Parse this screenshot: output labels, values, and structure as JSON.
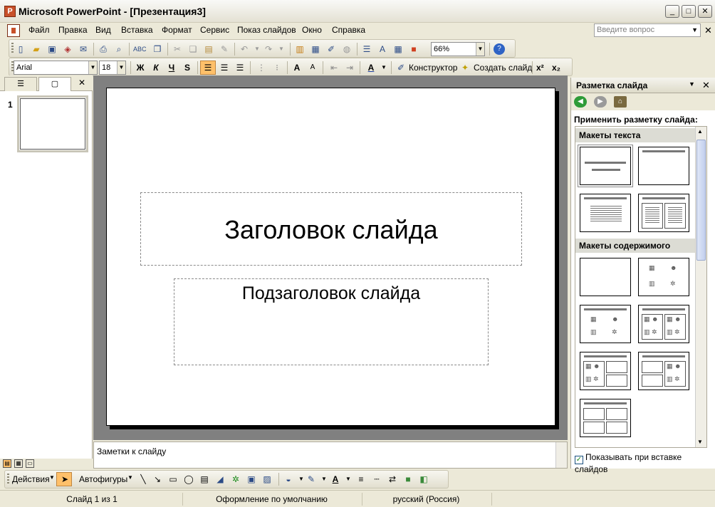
{
  "window": {
    "title": "Microsoft PowerPoint - [Презентация3]",
    "controls": {
      "minimize": "_",
      "maximize": "□",
      "close": "✕"
    }
  },
  "menubar": {
    "items": [
      "Файл",
      "Правка",
      "Вид",
      "Вставка",
      "Формат",
      "Сервис",
      "Показ слайдов",
      "Окно",
      "Справка"
    ],
    "ask_placeholder": "Введите вопрос",
    "close": "✕"
  },
  "standard_toolbar": {
    "zoom": "66%"
  },
  "formatting_toolbar": {
    "font": "Arial",
    "size": "18",
    "bold": "Ж",
    "italic": "К",
    "underline": "Ч",
    "shadow": "S",
    "designer": "Конструктор",
    "new_slide": "Создать слайд",
    "superscript": "x²",
    "subscript": "x₂"
  },
  "slides_pane": {
    "slide_number": "1",
    "close": "✕"
  },
  "slide": {
    "title_placeholder": "Заголовок слайда",
    "subtitle_placeholder": "Подзаголовок слайда"
  },
  "notes": {
    "placeholder": "Заметки к слайду"
  },
  "task_pane": {
    "title": "Разметка слайда",
    "close": "✕",
    "apply_label": "Применить разметку слайда:",
    "section_text": "Макеты текста",
    "section_content": "Макеты содержимого",
    "show_on_insert": "Показывать при вставке слайдов"
  },
  "drawing_toolbar": {
    "actions": "Действия",
    "autoshapes": "Автофигуры"
  },
  "status": {
    "slide": "Слайд 1 из 1",
    "design": "Оформление по умолчанию",
    "language": "русский (Россия)"
  },
  "colors": {
    "chrome": "#ece9d8",
    "canvas": "#808080",
    "active_button": "#ffc06a"
  }
}
